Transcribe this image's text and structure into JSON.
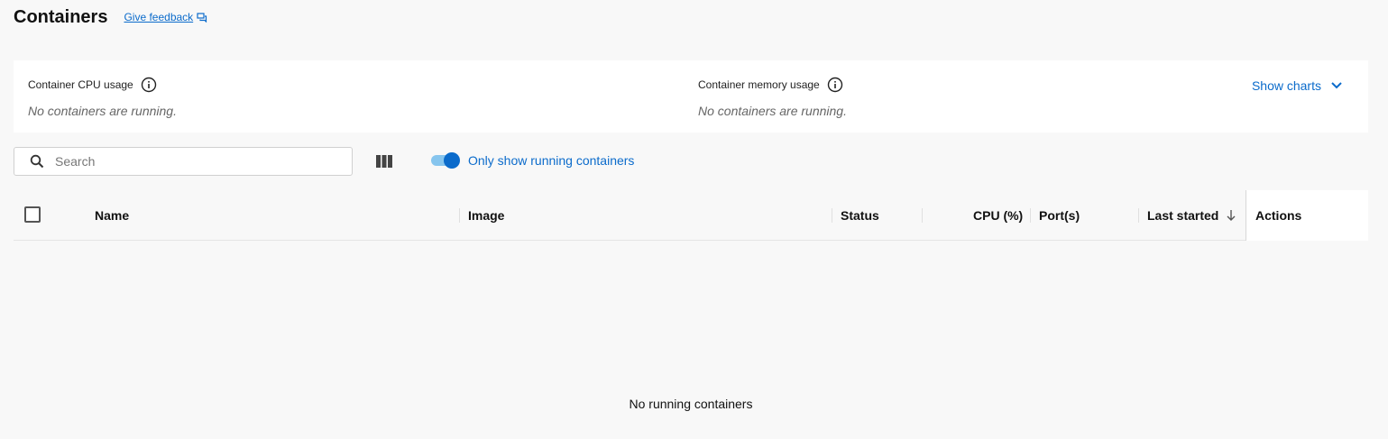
{
  "header": {
    "title": "Containers",
    "feedback_label": "Give feedback"
  },
  "stats": {
    "cpu_title": "Container CPU usage",
    "cpu_empty": "No containers are running.",
    "memory_title": "Container memory usage",
    "memory_empty": "No containers are running.",
    "show_charts_label": "Show charts"
  },
  "toolbar": {
    "search_placeholder": "Search",
    "search_value": "",
    "toggle_label": "Only show running containers",
    "toggle_on": true
  },
  "table": {
    "columns": [
      "Name",
      "Image",
      "Status",
      "CPU (%)",
      "Port(s)",
      "Last started",
      "Actions"
    ],
    "empty_message": "No running containers"
  },
  "colors": {
    "accent": "#0b6bcb",
    "toggle_track": "#86c5ee",
    "background": "#f8f8f8",
    "panel": "#ffffff"
  },
  "icons": {
    "feedback": "chat-bubbles-icon",
    "info": "info-icon",
    "chevron": "chevron-down-icon",
    "search": "search-icon",
    "columns": "columns-icon",
    "sort": "arrow-down-icon"
  }
}
